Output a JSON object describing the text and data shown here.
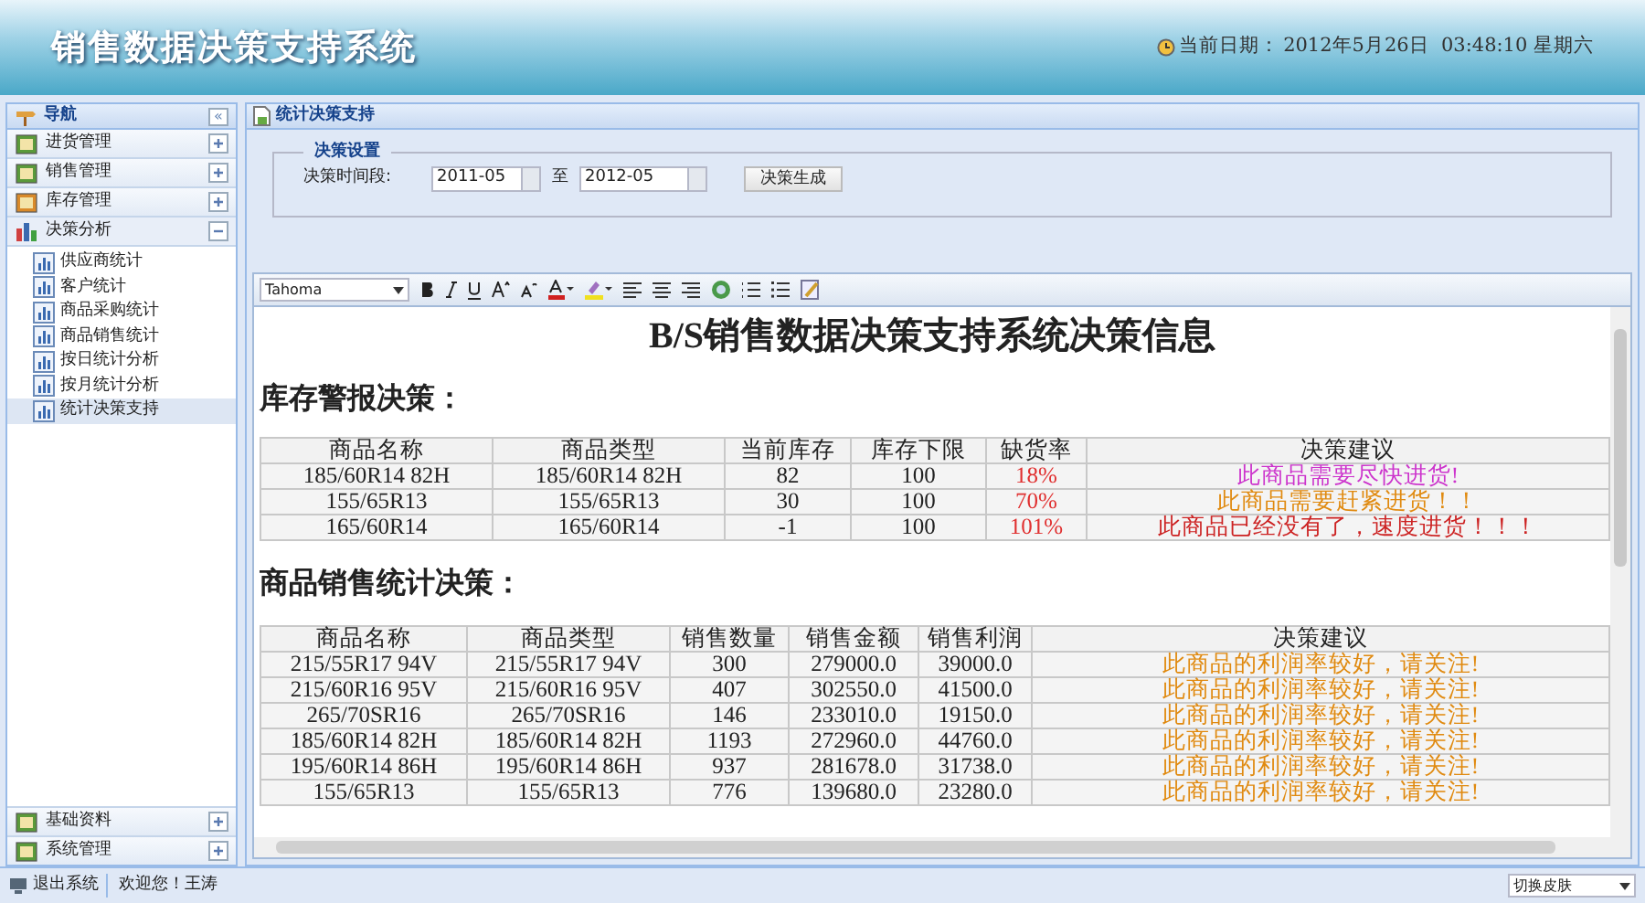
{
  "header": {
    "title": "销售数据决策支持系统",
    "date_label": "当前日期：",
    "date": "2012年5月26日  03:48:10 星期六"
  },
  "sidebar": {
    "title": "导航",
    "collapse": "«",
    "sections": [
      {
        "label": "进货管理",
        "expanded": false
      },
      {
        "label": "销售管理",
        "expanded": false
      },
      {
        "label": "库存管理",
        "expanded": false
      },
      {
        "label": "决策分析",
        "expanded": true,
        "children": [
          {
            "label": "供应商统计",
            "selected": false
          },
          {
            "label": "客户统计",
            "selected": false
          },
          {
            "label": "商品采购统计",
            "selected": false
          },
          {
            "label": "商品销售统计",
            "selected": false
          },
          {
            "label": "按日统计分析",
            "selected": false
          },
          {
            "label": "按月统计分析",
            "selected": false
          },
          {
            "label": "统计决策支持",
            "selected": true
          }
        ]
      }
    ],
    "bottom_sections": [
      {
        "label": "基础资料",
        "expanded": false
      },
      {
        "label": "系统管理",
        "expanded": false
      }
    ]
  },
  "panel": {
    "title": "统计决策支持",
    "settings": {
      "legend": "决策设置",
      "label": "决策时间段:",
      "from": "2011-05",
      "to_label": "至",
      "to": "2012-05",
      "button": "决策生成"
    }
  },
  "editor": {
    "font": "Tahoma",
    "doc_title": "B/S销售数据决策支持系统决策信息",
    "stock": {
      "heading": "库存警报决策：",
      "columns": [
        "商品名称",
        "商品类型",
        "当前库存",
        "库存下限",
        "缺货率",
        "决策建议"
      ],
      "rows": [
        {
          "cells": [
            "185/60R14 82H",
            "185/60R14 82H",
            "82",
            "100",
            "18%"
          ],
          "advice": "此商品需要尽快进货!",
          "color": "#cc33cc"
        },
        {
          "cells": [
            "155/65R13",
            "155/65R13",
            "30",
            "100",
            "70%"
          ],
          "advice": "此商品需要赶紧进货！！",
          "color": "#e08a10"
        },
        {
          "cells": [
            "165/60R14",
            "165/60R14",
            "-1",
            "100",
            "101%"
          ],
          "advice": "此商品已经没有了，速度进货！！！",
          "color": "#cc2222"
        }
      ]
    },
    "sales": {
      "heading": "商品销售统计决策：",
      "columns": [
        "商品名称",
        "商品类型",
        "销售数量",
        "销售金额",
        "销售利润",
        "决策建议"
      ],
      "rows": [
        {
          "cells": [
            "215/55R17 94V",
            "215/55R17 94V",
            "300",
            "279000.0",
            "39000.0"
          ],
          "advice": "此商品的利润率较好，请关注!"
        },
        {
          "cells": [
            "215/60R16 95V",
            "215/60R16 95V",
            "407",
            "302550.0",
            "41500.0"
          ],
          "advice": "此商品的利润率较好，请关注!"
        },
        {
          "cells": [
            "265/70SR16",
            "265/70SR16",
            "146",
            "233010.0",
            "19150.0"
          ],
          "advice": "此商品的利润率较好，请关注!"
        },
        {
          "cells": [
            "185/60R14 82H",
            "185/60R14 82H",
            "1193",
            "272960.0",
            "44760.0"
          ],
          "advice": "此商品的利润率较好，请关注!"
        },
        {
          "cells": [
            "195/60R14 86H",
            "195/60R14 86H",
            "937",
            "281678.0",
            "31738.0"
          ],
          "advice": "此商品的利润率较好，请关注!"
        },
        {
          "cells": [
            "155/65R13",
            "155/65R13",
            "776",
            "139680.0",
            "23280.0"
          ],
          "advice": "此商品的利润率较好，请关注!"
        }
      ]
    }
  },
  "status_bar": {
    "logout": "退出系统",
    "welcome": "欢迎您！王涛",
    "skin": "切换皮肤"
  }
}
